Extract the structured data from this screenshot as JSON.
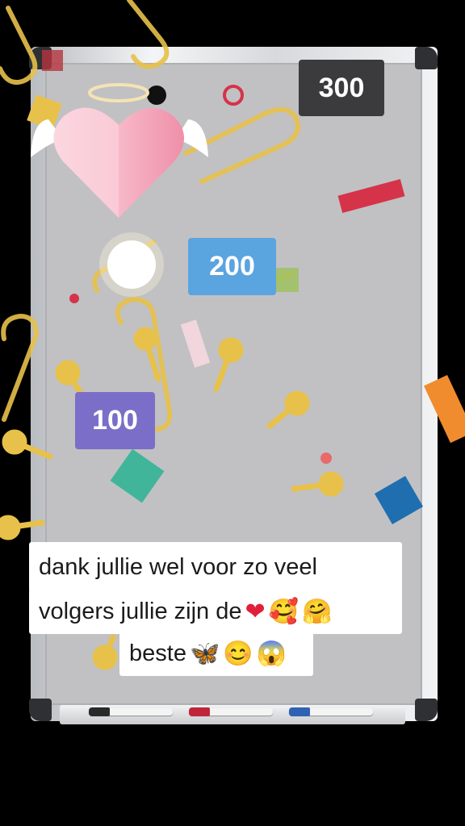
{
  "scores": {
    "top": "300",
    "middle": "200",
    "bottom": "100"
  },
  "caption": {
    "line1": "dank jullie wel voor zo veel",
    "line2_text": "volgers jullie zijn de",
    "line2_emojis": [
      "❤",
      "🥰",
      "🤗"
    ],
    "line3_text": "beste",
    "line3_emojis": [
      "🦋",
      "😊",
      "😱"
    ]
  },
  "icons": {
    "angel_heart": "winged-heart-with-halo",
    "markers": [
      "black-marker",
      "red-marker",
      "blue-marker"
    ]
  },
  "colors": {
    "background": "#000000",
    "board": "#c1c1c3",
    "score_300": "#3b3b3d",
    "score_200": "#5aa4e0",
    "score_100": "#7b6ec8",
    "confetti_yellow": "#e7c14a",
    "confetti_red": "#d5334a",
    "confetti_teal": "#41b59a",
    "confetti_blue": "#1f6fb0",
    "confetti_orange": "#f08c2e"
  }
}
